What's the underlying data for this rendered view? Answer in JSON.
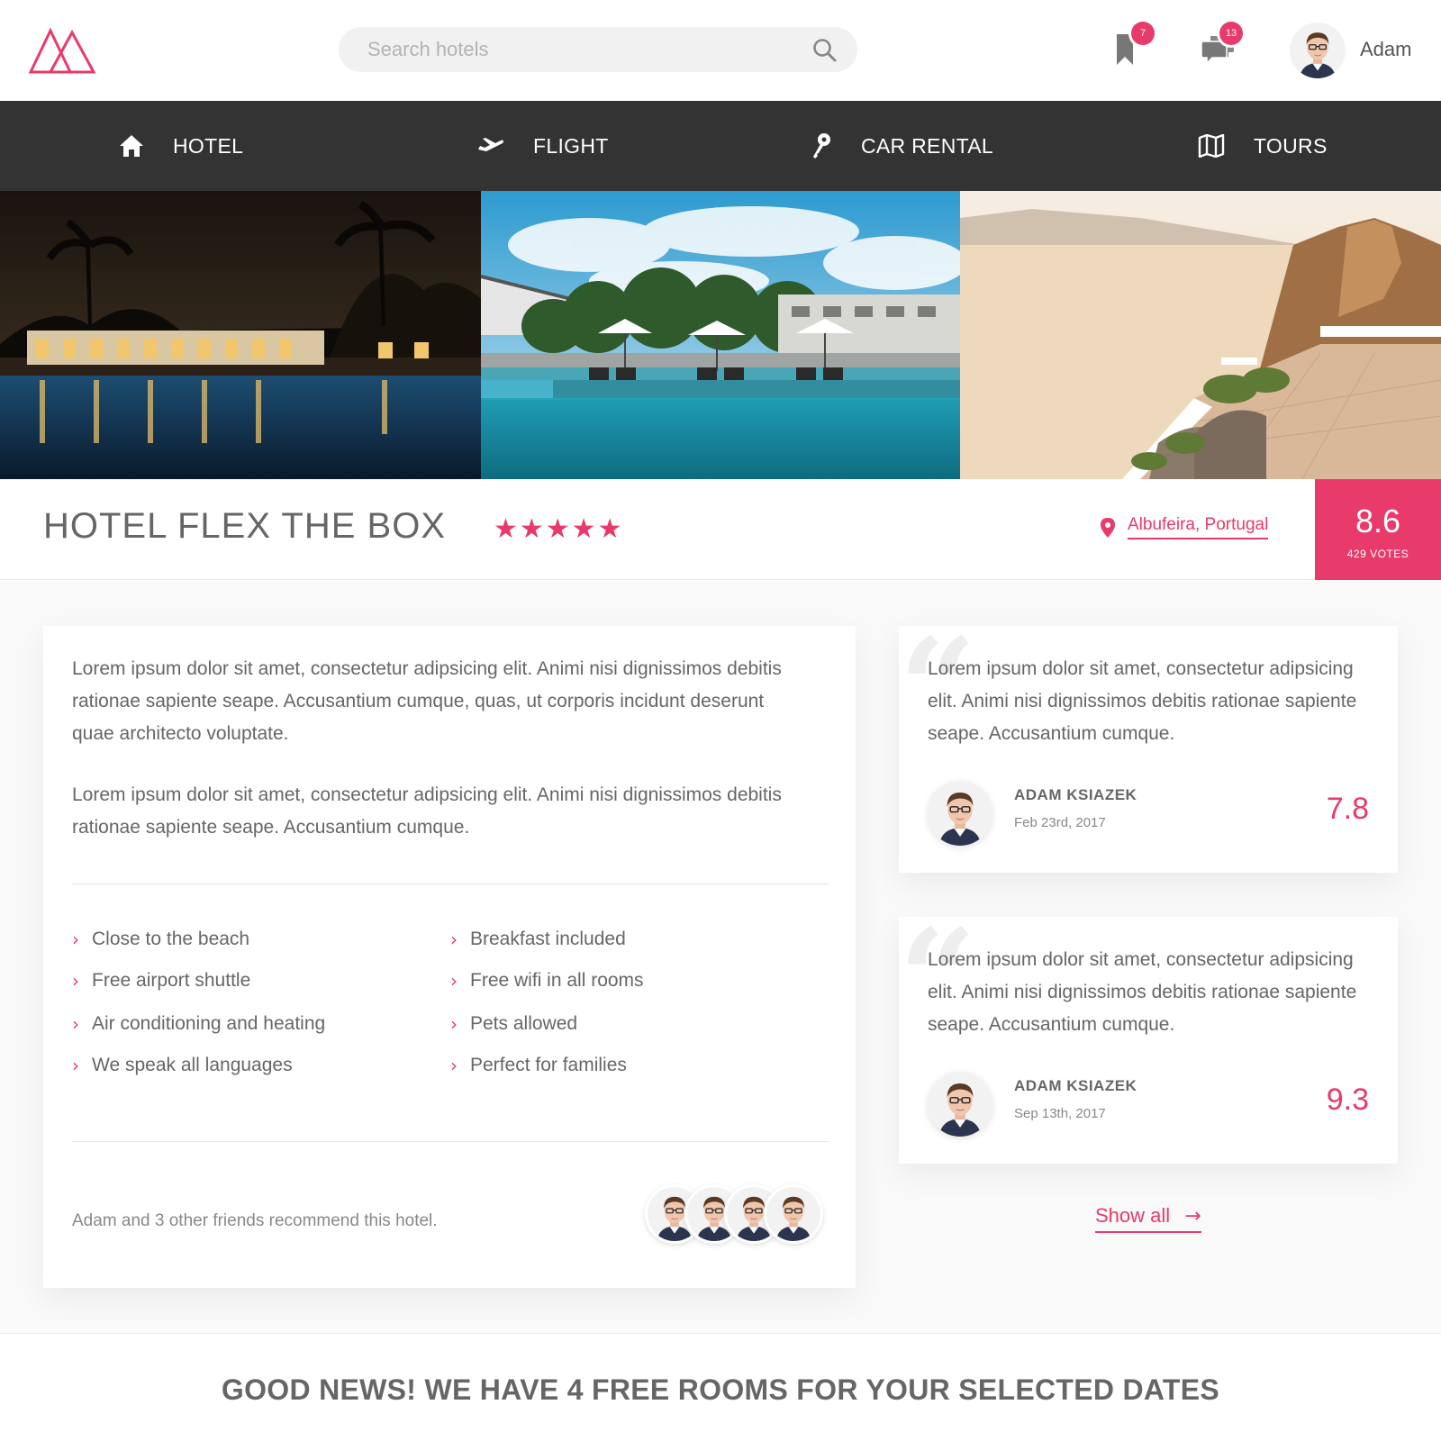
{
  "header": {
    "search_placeholder": "Search hotels",
    "bookmark_count": "7",
    "message_count": "13",
    "user_name": "Adam"
  },
  "nav": {
    "items": [
      {
        "label": "HOTEL",
        "icon": "home-icon"
      },
      {
        "label": "FLIGHT",
        "icon": "plane-icon"
      },
      {
        "label": "CAR RENTAL",
        "icon": "key-icon"
      },
      {
        "label": "TOURS",
        "icon": "map-icon"
      }
    ]
  },
  "gallery": {
    "photos": [
      "night-pool-resort",
      "daytime-pool-umbrellas",
      "cliffside-terrace-sea"
    ]
  },
  "hotel": {
    "title": "HOTEL FLEX THE BOX",
    "stars": "★★★★★",
    "location": "Albufeira, Portugal",
    "score": "8.6",
    "votes": "429 VOTES"
  },
  "description": {
    "paragraphs": [
      "Lorem ipsum dolor sit amet, consectetur adipsicing elit. Animi nisi dignissimos debitis rationae sapiente seape. Accusantium cumque, quas, ut corporis incidunt deserunt quae architecto voluptate.",
      "Lorem ipsum dolor sit amet, consectetur adipsicing elit. Animi nisi dignissimos debitis rationae sapiente seape. Accusantium cumque."
    ]
  },
  "amenities": [
    "Close to the beach",
    "Free airport shuttle",
    "Air conditioning and heating",
    "We speak all languages",
    "Breakfast included",
    "Free wifi in all rooms",
    "Pets allowed",
    "Perfect for families"
  ],
  "recommend_text": "Adam and 3 other friends recommend this hotel.",
  "reviews": [
    {
      "text": "Lorem ipsum dolor sit amet, consectetur adipsicing elit. Animi nisi dignissimos debitis rationae sapiente seape. Accusantium cumque.",
      "author": "ADAM KSIAZEK",
      "date": "Feb 23rd, 2017",
      "score": "7.8"
    },
    {
      "text": "Lorem ipsum dolor sit amet, consectetur adipsicing elit. Animi nisi dignissimos debitis rationae sapiente seape. Accusantium cumque.",
      "author": "ADAM KSIAZEK",
      "date": "Sep 13th, 2017",
      "score": "9.3"
    }
  ],
  "show_all": "Show all",
  "show_all_arrow": "→",
  "banner": "GOOD NEWS! WE HAVE 4 FREE ROOMS FOR YOUR SELECTED DATES",
  "colors": {
    "accent": "#e83a6b",
    "nav_bg": "#333333",
    "content_bg": "#f9f9f9"
  }
}
